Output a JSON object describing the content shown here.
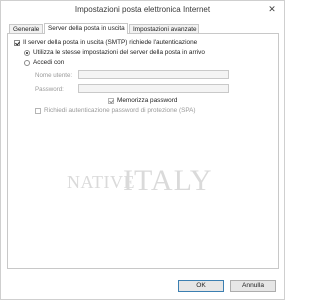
{
  "window": {
    "title": "Impostazioni posta elettronica Internet",
    "close_glyph": "✕"
  },
  "tabs": [
    {
      "label": "Generale",
      "active": false
    },
    {
      "label": "Server della posta in uscita",
      "active": true
    },
    {
      "label": "Impostazioni avanzate",
      "active": false
    }
  ],
  "outgoing": {
    "smtp_auth_label": "Il server della posta in uscita (SMTP) richiede l'autenticazione",
    "smtp_auth_checked": true,
    "use_same_label": "Utilizza le stesse impostazioni del server della posta in arrivo",
    "use_same_selected": true,
    "login_with_label": "Accedi con",
    "login_with_selected": false,
    "username_label": "Nome utente:",
    "username_value": "",
    "password_label": "Password:",
    "password_value": "",
    "remember_label": "Memorizza password",
    "remember_checked": true,
    "spa_label": "Richiedi autenticazione password di protezione (SPA)",
    "spa_checked": false
  },
  "watermark": {
    "part1": "NATIVE",
    "part2": "ITALY"
  },
  "buttons": {
    "ok": "OK",
    "cancel": "Annulla"
  }
}
